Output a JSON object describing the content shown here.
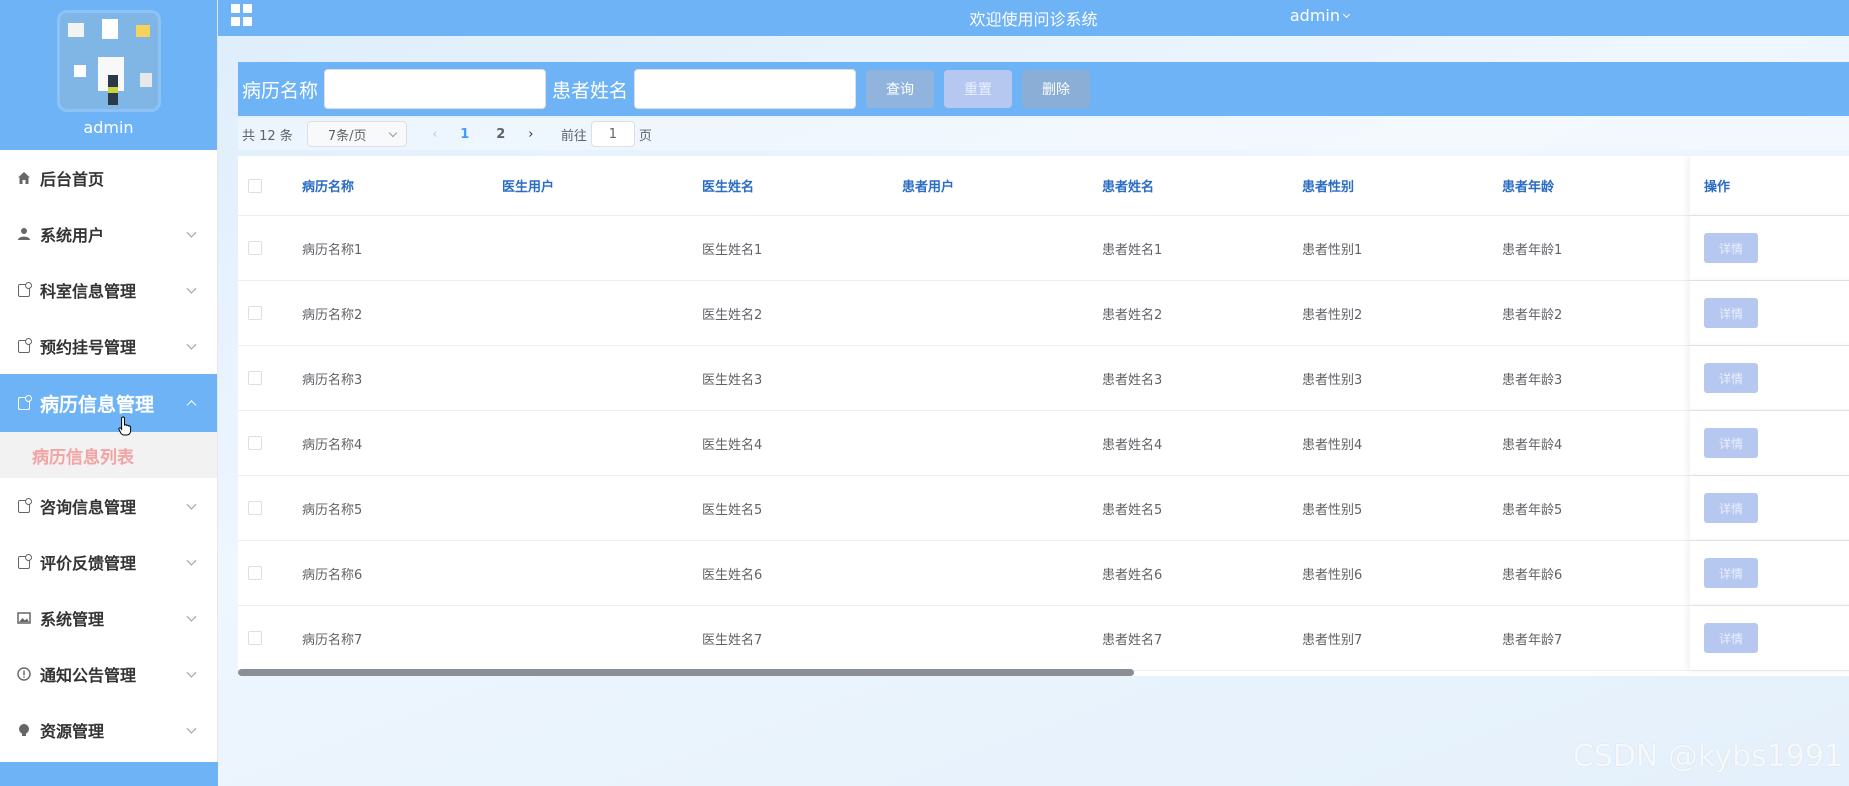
{
  "header": {
    "title": "欢迎使用问诊系统",
    "user": "admin"
  },
  "sidebar": {
    "profile_name": "admin",
    "items": [
      {
        "label": "后台首页",
        "icon": "home-icon"
      },
      {
        "label": "系统用户",
        "icon": "user-icon"
      },
      {
        "label": "科室信息管理",
        "icon": "doc-icon"
      },
      {
        "label": "预约挂号管理",
        "icon": "doc-icon"
      },
      {
        "label": "病历信息管理",
        "icon": "doc-icon",
        "active": true
      },
      {
        "label": "咨询信息管理",
        "icon": "doc-icon"
      },
      {
        "label": "评价反馈管理",
        "icon": "doc-icon"
      },
      {
        "label": "系统管理",
        "icon": "image-icon"
      },
      {
        "label": "通知公告管理",
        "icon": "info-icon"
      },
      {
        "label": "资源管理",
        "icon": "bulb-icon"
      }
    ],
    "subitem": "病历信息列表"
  },
  "search": {
    "label1": "病历名称",
    "label2": "患者姓名",
    "value1": "",
    "value2": "",
    "query": "查询",
    "reset": "重置",
    "delete": "删除"
  },
  "pager": {
    "total": "共 12 条",
    "size": "7条/页",
    "page1": "1",
    "page2": "2",
    "goto": "前往",
    "jump": "1",
    "suffix": "页"
  },
  "table": {
    "headers": [
      "病历名称",
      "医生用户",
      "医生姓名",
      "患者用户",
      "患者姓名",
      "患者性别",
      "患者年龄"
    ],
    "op_header": "操作",
    "detail": "详情",
    "rows": [
      [
        "病历名称1",
        "",
        "医生姓名1",
        "",
        "患者姓名1",
        "患者性别1",
        "患者年龄1"
      ],
      [
        "病历名称2",
        "",
        "医生姓名2",
        "",
        "患者姓名2",
        "患者性别2",
        "患者年龄2"
      ],
      [
        "病历名称3",
        "",
        "医生姓名3",
        "",
        "患者姓名3",
        "患者性别3",
        "患者年龄3"
      ],
      [
        "病历名称4",
        "",
        "医生姓名4",
        "",
        "患者姓名4",
        "患者性别4",
        "患者年龄4"
      ],
      [
        "病历名称5",
        "",
        "医生姓名5",
        "",
        "患者姓名5",
        "患者性别5",
        "患者年龄5"
      ],
      [
        "病历名称6",
        "",
        "医生姓名6",
        "",
        "患者姓名6",
        "患者性别6",
        "患者年龄6"
      ],
      [
        "病历名称7",
        "",
        "医生姓名7",
        "",
        "患者姓名7",
        "患者性别7",
        "患者年龄7"
      ]
    ]
  },
  "watermark": "CSDN @kybs1991",
  "colors": {
    "primary": "#6eb3f5",
    "header_text": "#2b6cc4",
    "submenu_text": "#f2a3a3"
  }
}
